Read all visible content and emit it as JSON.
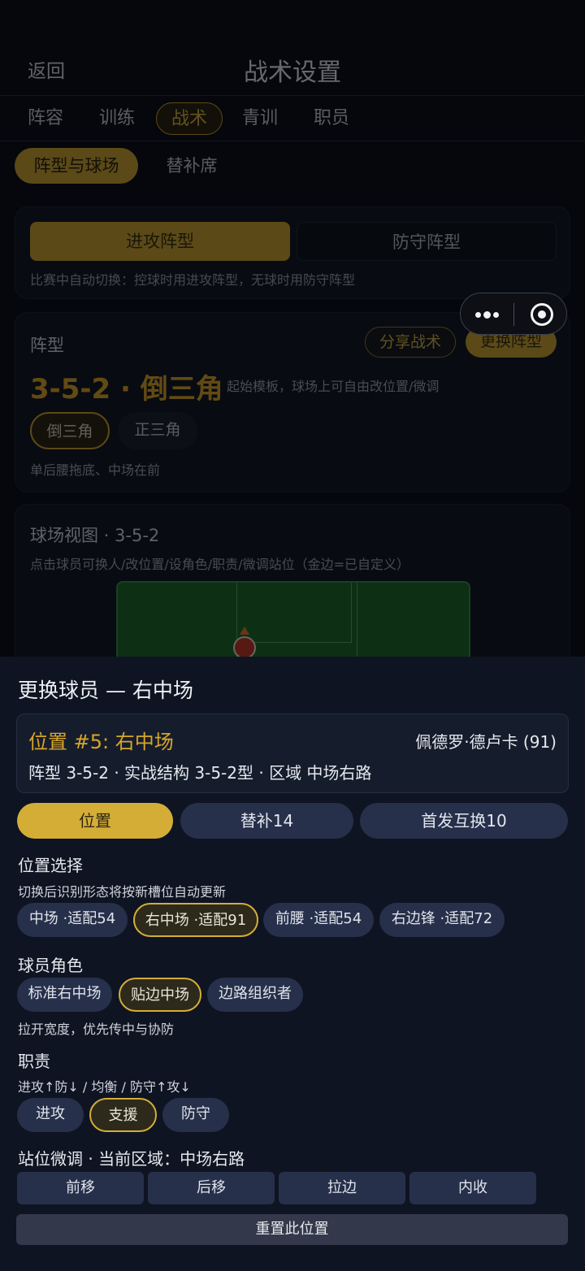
{
  "header": {
    "back": "返回",
    "title": "战术设置"
  },
  "tabs": [
    "阵容",
    "训练",
    "战术",
    "青训",
    "职员"
  ],
  "subtabs": [
    "阵型与球场",
    "替补席"
  ],
  "formation_mode": {
    "attack": "进攻阵型",
    "defense": "防守阵型",
    "note": "比赛中自动切换：控球时用进攻阵型，无球时用防守阵型"
  },
  "formation": {
    "label": "阵型",
    "share": "分享战术",
    "change": "更换阵型",
    "name": "3-5-2 · 倒三角",
    "template_note": "起始模板，球场上可自由改位置/微调",
    "variants": [
      "倒三角",
      "正三角"
    ],
    "variant_note": "单后腰拖底、中场在前"
  },
  "pitch_view": {
    "title": "球场视图 · 3-5-2",
    "note": "点击球员可换人/改位置/设角色/职责/微调站位（金边=已自定义）"
  },
  "sheet": {
    "title": "更换球员 — 右中场",
    "position_title": "位置 #5: 右中场",
    "player": "佩德罗·德卢卡 (91)",
    "meta": "阵型 3-5-2 · 实战结构 3-5-2型 · 区域 中场右路",
    "modes": [
      "位置",
      "替补14",
      "首发互换10"
    ],
    "position_select": {
      "label": "位置选择",
      "note": "切换后识别形态将按新槽位自动更新",
      "options": [
        "中场 ·适配54",
        "右中场 ·适配91",
        "前腰 ·适配54",
        "右边锋 ·适配72"
      ]
    },
    "role": {
      "label": "球员角色",
      "options": [
        "标准右中场",
        "贴边中场",
        "边路组织者"
      ],
      "note": "拉开宽度，优先传中与协防"
    },
    "duty": {
      "label": "职责",
      "note": "进攻↑防↓ / 均衡 / 防守↑攻↓",
      "options": [
        "进攻",
        "支援",
        "防守"
      ]
    },
    "adjust": {
      "label": "站位微调 · 当前区域：中场右路",
      "options": [
        "前移",
        "后移",
        "拉边",
        "内收"
      ],
      "reset": "重置此位置"
    }
  },
  "colors": {
    "gold": "#d4ad37",
    "sheet_bg": "#0e1421",
    "chip_bg": "#26304a"
  },
  "icons": [
    "more-icon",
    "target-icon"
  ]
}
